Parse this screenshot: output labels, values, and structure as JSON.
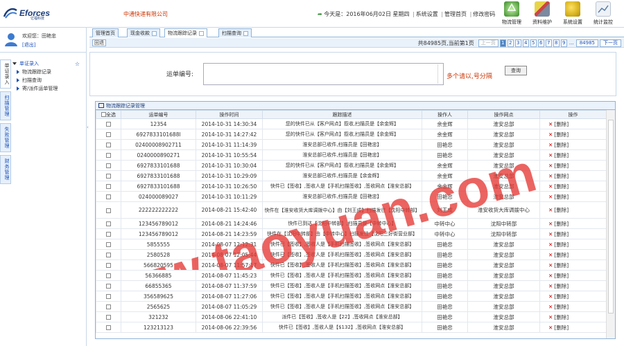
{
  "header": {
    "logo_text": "Eforces",
    "logo_sub": "亿福科技",
    "company": "中通快递有限公司",
    "date_prefix": "今天是：",
    "date": "2016年06月02日 星期四",
    "links": [
      "系统设置",
      "管理首页",
      "修改密码"
    ]
  },
  "top_icons": [
    {
      "label": "物流管理",
      "icon": "recycle-icon",
      "color": "#3a8a2a"
    },
    {
      "label": "资料维护",
      "icon": "brush-icon",
      "color": "#7a8aa0"
    },
    {
      "label": "系统设置",
      "icon": "gears-icon",
      "color": "#d6b21c"
    },
    {
      "label": "统计监控",
      "icon": "chart-icon",
      "color": "#5a7aa8"
    }
  ],
  "user": {
    "welcome": "欢迎您：田艳忠",
    "logout": "[退出]"
  },
  "vtabs": [
    "单证录入",
    "扫描管理",
    "失败管理",
    "财务管理"
  ],
  "tree": {
    "head": "单证录入",
    "items": [
      "物流跟踪记录",
      "扫描查询",
      "寄/派件运单管理"
    ]
  },
  "tabs": [
    {
      "label": "管理首页",
      "closable": false
    },
    {
      "label": "现金收款",
      "closable": true
    },
    {
      "label": "物流跟踪记录",
      "closable": true
    },
    {
      "label": "扫描查询",
      "closable": true
    }
  ],
  "toolbar": {
    "back": "回退"
  },
  "pager": {
    "info": "共84985页,当前第1页",
    "prev": "上一页",
    "pages": [
      "1",
      "2",
      "3",
      "4",
      "5",
      "6",
      "7",
      "8",
      "9"
    ],
    "ellipsis": "...",
    "last": "84985",
    "next": "下一页"
  },
  "search": {
    "label": "运单编号:",
    "value": "",
    "hint": "多个请以,号分隔",
    "button": "查询"
  },
  "grid": {
    "title": "物流跟踪记录管理",
    "columns": [
      "全选",
      "运单编号",
      "操作时间",
      "跟踪描述",
      "操作人",
      "操作网点",
      "操作"
    ],
    "delete_label": "[删除]",
    "rows": [
      [
        "12354",
        "2014-10-31 14:30:34",
        "您的快件已从【客户网点】揽收,扫描员是【余金辉】",
        "余金辉",
        "淮安总部"
      ],
      [
        "6927833101688l",
        "2014-10-31 14:27:42",
        "您的快件已从【客户网点】揽收,扫描员是【余金辉】",
        "余金辉",
        "淮安总部"
      ],
      [
        "02400008902711",
        "2014-10-31 11:14:39",
        "淮安总部已收件,扫描员是【田艳忠】",
        "田艳忠",
        "淮安总部"
      ],
      [
        "0240000890271",
        "2014-10-31 10:55:54",
        "淮安总部已收件,扫描员是【田艳忠】",
        "田艳忠",
        "淮安总部"
      ],
      [
        "6927833101688",
        "2014-10-31 10:30:04",
        "您的快件已从【客户网点】揽收,扫描员是【余金辉】",
        "余金辉",
        "淮安总部"
      ],
      [
        "6927833101688",
        "2014-10-31 10:29:09",
        "淮安总部已收件,扫描员是【余金辉】",
        "余金辉",
        "淮安总部"
      ],
      [
        "6927833101688",
        "2014-10-31 10:26:50",
        "快件已【签收】,签收人是【手机扫描签收】,签收网点【淮安总部】",
        "余金辉",
        "淮安总部"
      ],
      [
        "024000089027",
        "2014-10-31 10:11:29",
        "淮安总部已收件,扫描员是【田艳忠】",
        "田艳忠",
        "淮安总部"
      ],
      [
        "222222222222",
        "2014-08-21 15:42:40",
        "快件在【淮安收货大库调拨中心】由【刘王成】扫描发往【沈阳中转部】",
        "刘王成",
        "淮安收货大库调拨中心"
      ],
      [
        "123456789012",
        "2014-08-21 14:24:46",
        "快件已到达【沈阳中转部】,扫描员是【中转中心】",
        "中转中心",
        "沈阳中转部"
      ],
      [
        "123456789012",
        "2014-08-21 14:23:59",
        "快件在【沈阳中转部】由【中转中心】扫描发往【沈阳三好街营业部】",
        "中转中心",
        "沈阳中转部"
      ],
      [
        "5855555",
        "2014-08-07 12:12:31",
        "快件已【签收】,签收人是【手机扫描签收】,签收网点【淮安总部】",
        "田艳忠",
        "淮安总部"
      ],
      [
        "2580528",
        "2014-08-07 12:05:44",
        "快件已【签收】,签收人是【手机扫描签收】,签收网点【淮安总部】",
        "田艳忠",
        "淮安总部"
      ],
      [
        "566820595",
        "2014-08-07 11:57:17",
        "快件已【签收】,签收人是【手机扫描签收】,签收网点【淮安总部】",
        "田艳忠",
        "淮安总部"
      ],
      [
        "56366885",
        "2014-08-07 11:45:23",
        "快件已【签收】,签收人是【手机扫描签收】,签收网点【淮安总部】",
        "田艳忠",
        "淮安总部"
      ],
      [
        "66855365",
        "2014-08-07 11:37:59",
        "快件已【签收】,签收人是【手机扫描签收】,签收网点【淮安总部】",
        "田艳忠",
        "淮安总部"
      ],
      [
        "356589625",
        "2014-08-07 11:27:06",
        "快件已【签收】,签收人是【手机扫描签收】,签收网点【淮安总部】",
        "田艳忠",
        "淮安总部"
      ],
      [
        "2565625",
        "2014-08-07 11:05:29",
        "快件已【签收】,签收人是【手机扫描签收】,签收网点【淮安总部】",
        "田艳忠",
        "淮安总部"
      ],
      [
        "321232",
        "2014-08-06 22:41:10",
        "派件已【签收】,签收人是【22】,签收网点【淮安总部】",
        "田艳忠",
        "淮安总部"
      ],
      [
        "123213123",
        "2014-08-06 22:39:56",
        "快件已【签收】,签收人是【$132】,签收网点【淮安总部】",
        "田艳忠",
        "淮安总部"
      ]
    ]
  },
  "watermark": {
    "text": "www.taoyuan.com",
    "color": "#e53935"
  }
}
